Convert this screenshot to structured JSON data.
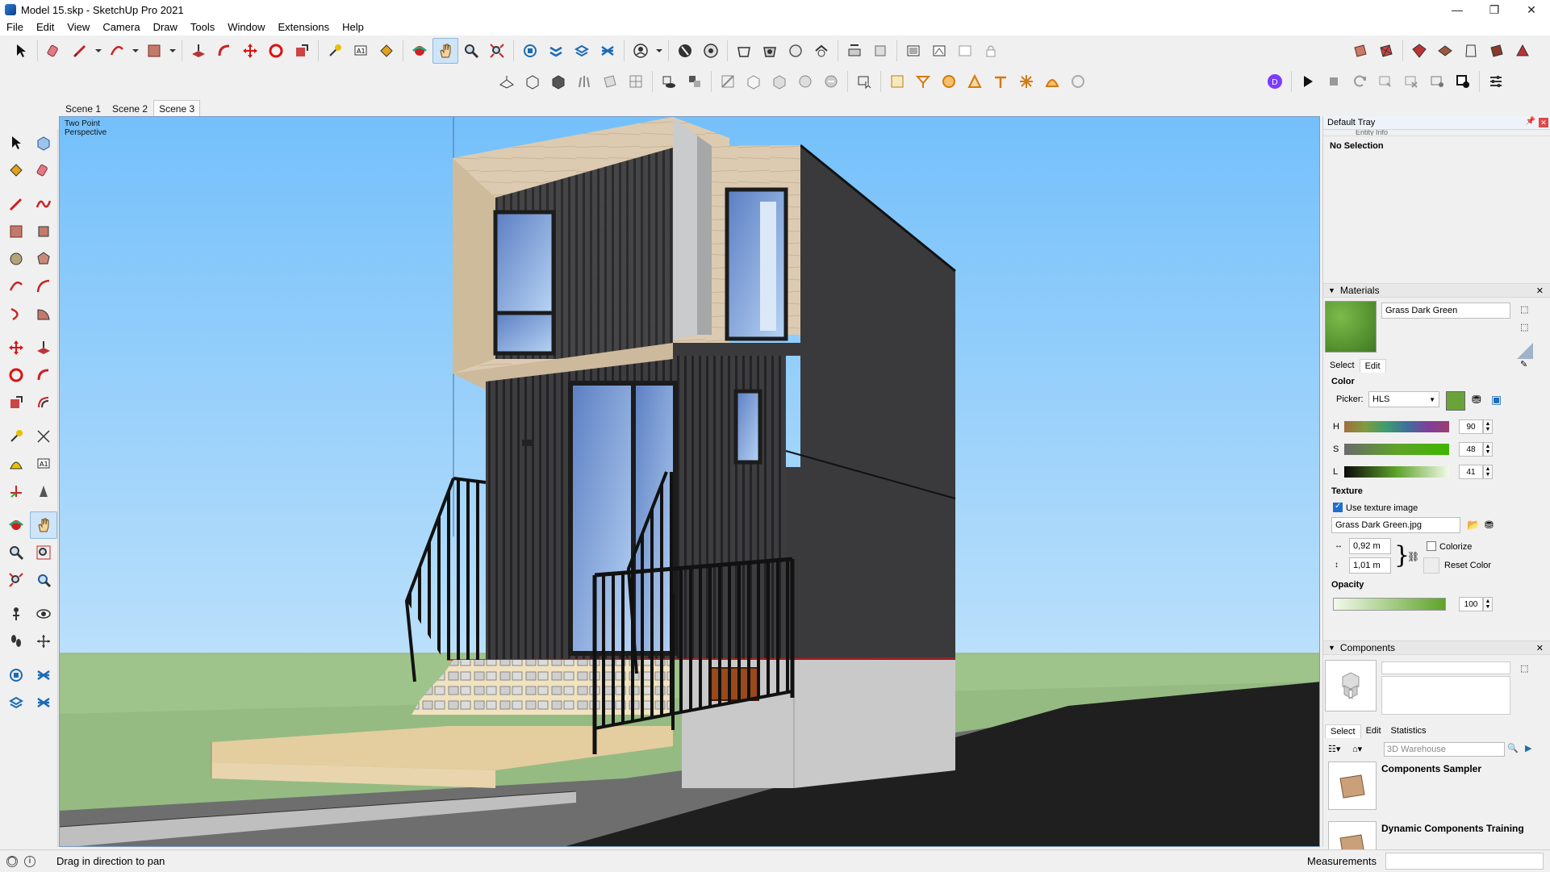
{
  "window": {
    "title": "Model 15.skp - SketchUp Pro 2021",
    "minimize": "—",
    "maximize": "❐",
    "close": "✕"
  },
  "menu": [
    "File",
    "Edit",
    "View",
    "Camera",
    "Draw",
    "Tools",
    "Window",
    "Extensions",
    "Help"
  ],
  "scenes": {
    "tabs": [
      "Scene 1",
      "Scene 2",
      "Scene 3"
    ],
    "active": "Scene 3"
  },
  "viewport": {
    "camera_label": "Two Point",
    "camera_label2": "Perspective"
  },
  "tray": {
    "title": "Default Tray",
    "entity_info": {
      "header": "Entity Info",
      "selection": "No Selection"
    },
    "materials": {
      "header": "Materials",
      "material_name": "Grass Dark Green",
      "swatch_color": "#5a9b2e",
      "tabs": [
        "Select",
        "Edit"
      ],
      "color_label": "Color",
      "picker_label": "Picker:",
      "picker_value": "HLS",
      "h_label": "H",
      "h_value": "90",
      "s_label": "S",
      "s_value": "48",
      "l_label": "L",
      "l_value": "41",
      "texture_label": "Texture",
      "use_texture_label": "Use texture image",
      "texture_file": "Grass Dark Green.jpg",
      "width_value": "0,92 m",
      "height_value": "1,01 m",
      "colorize_label": "Colorize",
      "reset_color_label": "Reset Color",
      "opacity_label": "Opacity",
      "opacity_value": "100"
    },
    "components": {
      "header": "Components",
      "tabs": [
        "Select",
        "Edit",
        "Statistics"
      ],
      "search_placeholder": "3D Warehouse",
      "items": [
        "Components Sampler",
        "Dynamic Components Training"
      ]
    }
  },
  "status": {
    "hint": "Drag in direction to pan",
    "measurements_label": "Measurements"
  },
  "colors": {
    "sky_top": "#7cc6fb",
    "ground": "#9ec48b",
    "dark_cladding": "#3a3a3c",
    "wood": "#d9c7ad"
  }
}
